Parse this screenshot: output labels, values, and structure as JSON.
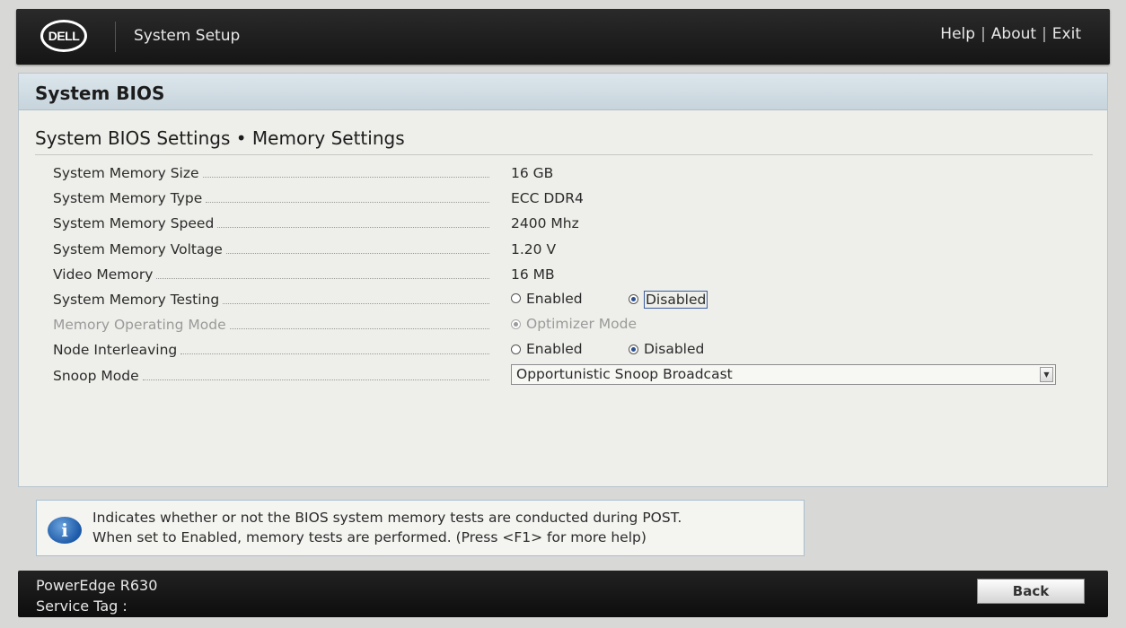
{
  "header": {
    "logo_text": "DELL",
    "app_title": "System Setup",
    "links": {
      "help": "Help",
      "about": "About",
      "exit": "Exit",
      "separator": "|"
    }
  },
  "section": {
    "title": "System BIOS",
    "breadcrumb": "System BIOS Settings • Memory Settings"
  },
  "settings": {
    "memory_size": {
      "label": "System Memory Size",
      "value": "16 GB"
    },
    "memory_type": {
      "label": "System Memory Type",
      "value": "ECC DDR4"
    },
    "memory_speed": {
      "label": "System Memory Speed",
      "value": "2400 Mhz"
    },
    "memory_voltage": {
      "label": "System Memory Voltage",
      "value": "1.20 V"
    },
    "video_memory": {
      "label": "Video Memory",
      "value": "16 MB"
    },
    "memory_testing": {
      "label": "System Memory Testing",
      "options": [
        "Enabled",
        "Disabled"
      ],
      "selected": "Disabled"
    },
    "operating_mode": {
      "label": "Memory Operating Mode",
      "options": [
        "Optimizer Mode"
      ],
      "selected": "Optimizer Mode",
      "disabled": true
    },
    "node_interleaving": {
      "label": "Node Interleaving",
      "options": [
        "Enabled",
        "Disabled"
      ],
      "selected": "Disabled"
    },
    "snoop_mode": {
      "label": "Snoop Mode",
      "selected": "Opportunistic Snoop Broadcast"
    }
  },
  "help": {
    "icon": "info-icon",
    "line1": "Indicates whether or not the BIOS system memory tests are conducted during POST.",
    "line2": "When set to Enabled, memory tests are performed. (Press <F1> for more help)"
  },
  "footer": {
    "model": "PowerEdge R630",
    "service_tag_label": "Service Tag :",
    "back_label": "Back"
  },
  "colors": {
    "header_bg": "#1a1a1a",
    "panel_bg": "#eeeeea",
    "section_bar": "#c7d4dc",
    "radio_selected": "#2d4f8c",
    "info_icon": "#1d5aa8"
  }
}
